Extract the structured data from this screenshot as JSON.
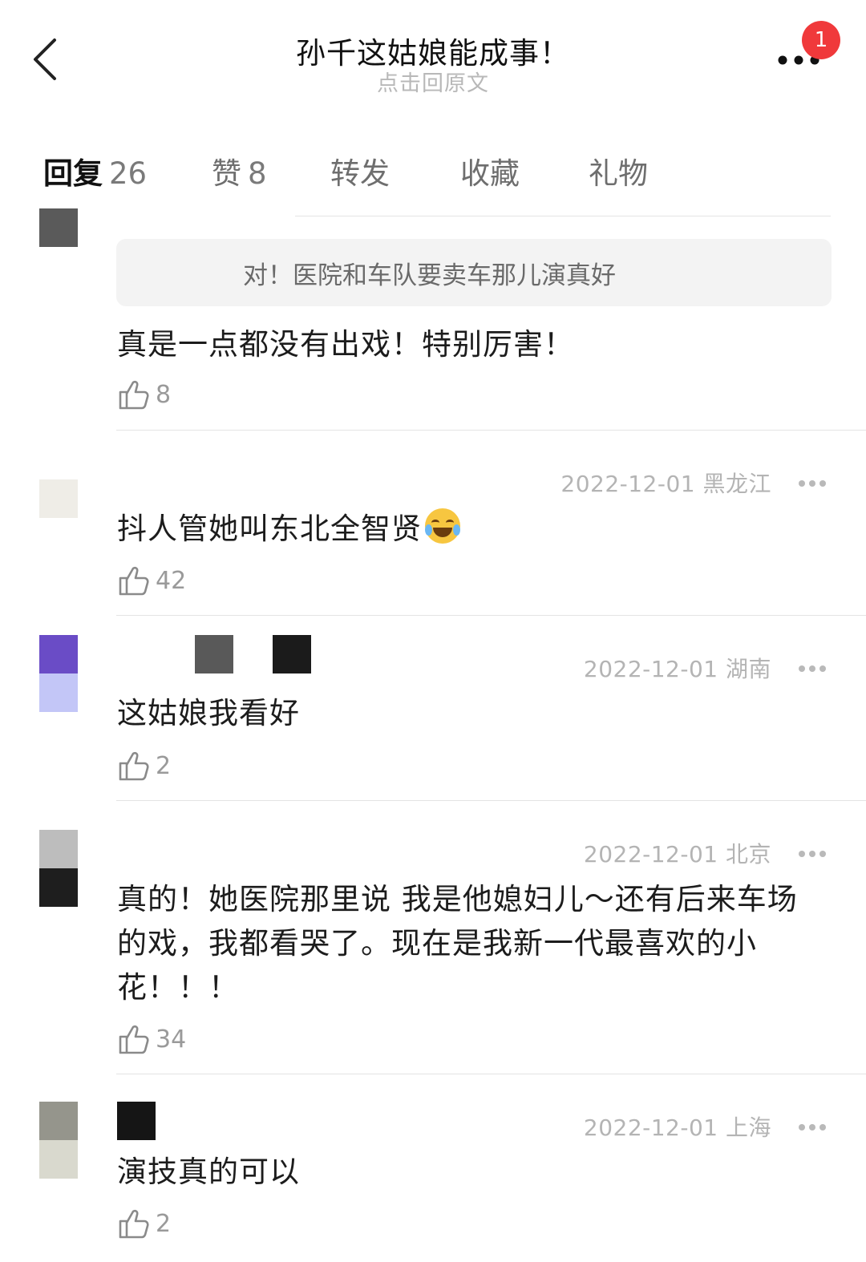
{
  "header": {
    "title": "孙千这姑娘能成事！",
    "subtitle": "点击回原文",
    "notification_badge": "1",
    "back_icon": "chevron-left-icon",
    "more_icon": "more-dots-icon"
  },
  "tabs": [
    {
      "label": "回复",
      "count": "26"
    },
    {
      "label": "赞",
      "count": "8"
    },
    {
      "label": "转发",
      "count": ""
    },
    {
      "label": "收藏",
      "count": ""
    },
    {
      "label": "礼物",
      "count": ""
    }
  ],
  "comments": [
    {
      "quote": "对！医院和车队要卖车那儿演真好",
      "text": "真是一点都没有出戏！特别厉害！",
      "likes": "8"
    },
    {
      "date_location": "2022-12-01 黑龙江",
      "text": "抖人管她叫东北全智贤",
      "emoji": "laughing-tears-emoji",
      "likes": "42"
    },
    {
      "date_location": "2022-12-01 湖南",
      "text": "这姑娘我看好",
      "likes": "2"
    },
    {
      "date_location": "2022-12-01 北京",
      "text": "真的！她医院那里说 我是他媳妇儿～还有后来车场的戏，我都看哭了。现在是我新一代最喜欢的小花！！！",
      "likes": "34"
    },
    {
      "date_location": "2022-12-01 上海",
      "text": "演技真的可以",
      "likes": "2"
    }
  ],
  "colors": {
    "badge": "#f0393b",
    "meta_text": "#b4b4b4",
    "quote_bg": "#f3f3f3"
  }
}
